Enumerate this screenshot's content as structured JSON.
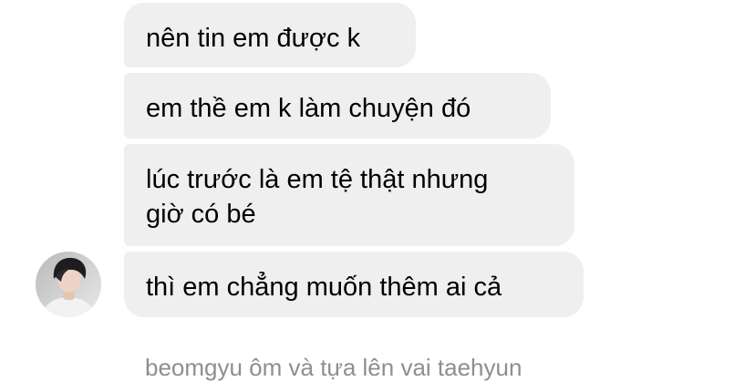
{
  "messages": [
    {
      "text": "nên tin em được k"
    },
    {
      "text": "em thề em k làm chuyện đó"
    },
    {
      "text": "lúc trước là em tệ thật nhưng\ngiờ có bé"
    },
    {
      "text": "thì em chẳng muốn thêm ai cả"
    }
  ],
  "sender": {
    "avatar_icon": "profile-photo"
  },
  "action_note": "beomgyu ôm và tựa lên vai taehyun",
  "colors": {
    "bubble_background": "#efeff0",
    "bubble_text": "#000000",
    "note_text": "#8e8e93",
    "page_background": "#ffffff"
  }
}
